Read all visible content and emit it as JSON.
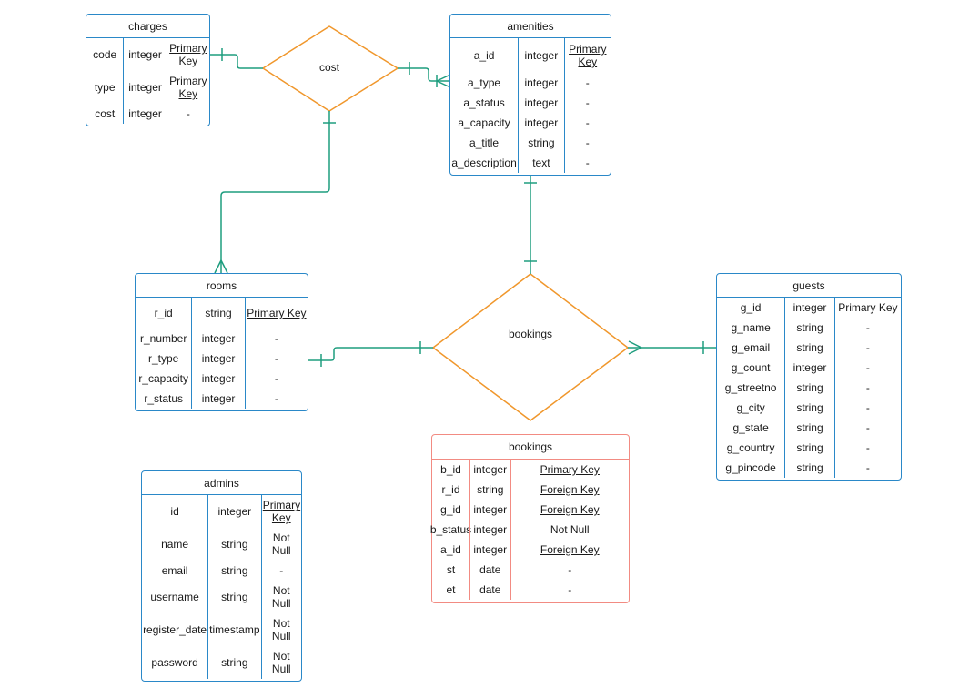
{
  "colors": {
    "entity_border": "#2a88c8",
    "bookings_table_border": "#f28b82",
    "relationship_border": "#f0972c",
    "connector": "#1f9d7f"
  },
  "relationships": {
    "cost": {
      "label": "cost"
    },
    "bookings": {
      "label": "bookings"
    }
  },
  "tables": {
    "charges": {
      "title": "charges",
      "rows": [
        {
          "name": "code",
          "type": "integer",
          "constraint": "Primary Key",
          "underline": true
        },
        {
          "name": "type",
          "type": "integer",
          "constraint": "Primary Key",
          "underline": true
        },
        {
          "name": "cost",
          "type": "integer",
          "constraint": "-",
          "underline": false
        }
      ]
    },
    "amenities": {
      "title": "amenities",
      "rows": [
        {
          "name": "a_id",
          "type": "integer",
          "constraint": "Primary Key",
          "underline": true
        },
        {
          "name": "a_type",
          "type": "integer",
          "constraint": "-",
          "underline": false
        },
        {
          "name": "a_status",
          "type": "integer",
          "constraint": "-",
          "underline": false
        },
        {
          "name": "a_capacity",
          "type": "integer",
          "constraint": "-",
          "underline": false
        },
        {
          "name": "a_title",
          "type": "string",
          "constraint": "-",
          "underline": false
        },
        {
          "name": "a_description",
          "type": "text",
          "constraint": "-",
          "underline": false
        }
      ]
    },
    "rooms": {
      "title": "rooms",
      "rows": [
        {
          "name": "r_id",
          "type": "string",
          "constraint": "Primary Key",
          "underline": true
        },
        {
          "name": "r_number",
          "type": "integer",
          "constraint": "-",
          "underline": false
        },
        {
          "name": "r_type",
          "type": "integer",
          "constraint": "-",
          "underline": false
        },
        {
          "name": "r_capacity",
          "type": "integer",
          "constraint": "-",
          "underline": false
        },
        {
          "name": "r_status",
          "type": "integer",
          "constraint": "-",
          "underline": false
        }
      ]
    },
    "guests": {
      "title": "guests",
      "rows": [
        {
          "name": "g_id",
          "type": "integer",
          "constraint": "Primary Key",
          "underline": false
        },
        {
          "name": "g_name",
          "type": "string",
          "constraint": "-",
          "underline": false
        },
        {
          "name": "g_email",
          "type": "string",
          "constraint": "-",
          "underline": false
        },
        {
          "name": "g_count",
          "type": "integer",
          "constraint": "-",
          "underline": false
        },
        {
          "name": "g_streetno",
          "type": "string",
          "constraint": "-",
          "underline": false
        },
        {
          "name": "g_city",
          "type": "string",
          "constraint": "-",
          "underline": false
        },
        {
          "name": "g_state",
          "type": "string",
          "constraint": "-",
          "underline": false
        },
        {
          "name": "g_country",
          "type": "string",
          "constraint": "-",
          "underline": false
        },
        {
          "name": "g_pincode",
          "type": "string",
          "constraint": "-",
          "underline": false
        }
      ]
    },
    "bookings": {
      "title": "bookings",
      "rows": [
        {
          "name": "b_id",
          "type": "integer",
          "constraint": "Primary Key",
          "underline": true
        },
        {
          "name": "r_id",
          "type": "string",
          "constraint": "Foreign Key",
          "underline": true
        },
        {
          "name": "g_id",
          "type": "integer",
          "constraint": "Foreign Key",
          "underline": true
        },
        {
          "name": "b_status",
          "type": "integer",
          "constraint": "Not Null",
          "underline": false
        },
        {
          "name": "a_id",
          "type": "integer",
          "constraint": "Foreign Key",
          "underline": true
        },
        {
          "name": "st",
          "type": "date",
          "constraint": "-",
          "underline": false
        },
        {
          "name": "et",
          "type": "date",
          "constraint": "-",
          "underline": false
        }
      ]
    },
    "admins": {
      "title": "admins",
      "rows": [
        {
          "name": "id",
          "type": "integer",
          "constraint": "Primary Key",
          "underline": true
        },
        {
          "name": "name",
          "type": "string",
          "constraint": "Not Null",
          "underline": false
        },
        {
          "name": "email",
          "type": "string",
          "constraint": "-",
          "underline": false
        },
        {
          "name": "username",
          "type": "string",
          "constraint": "Not Null",
          "underline": false
        },
        {
          "name": "register_date",
          "type": "timestamp",
          "constraint": "Not Null",
          "underline": false
        },
        {
          "name": "password",
          "type": "string",
          "constraint": "Not Null",
          "underline": false
        }
      ]
    }
  }
}
